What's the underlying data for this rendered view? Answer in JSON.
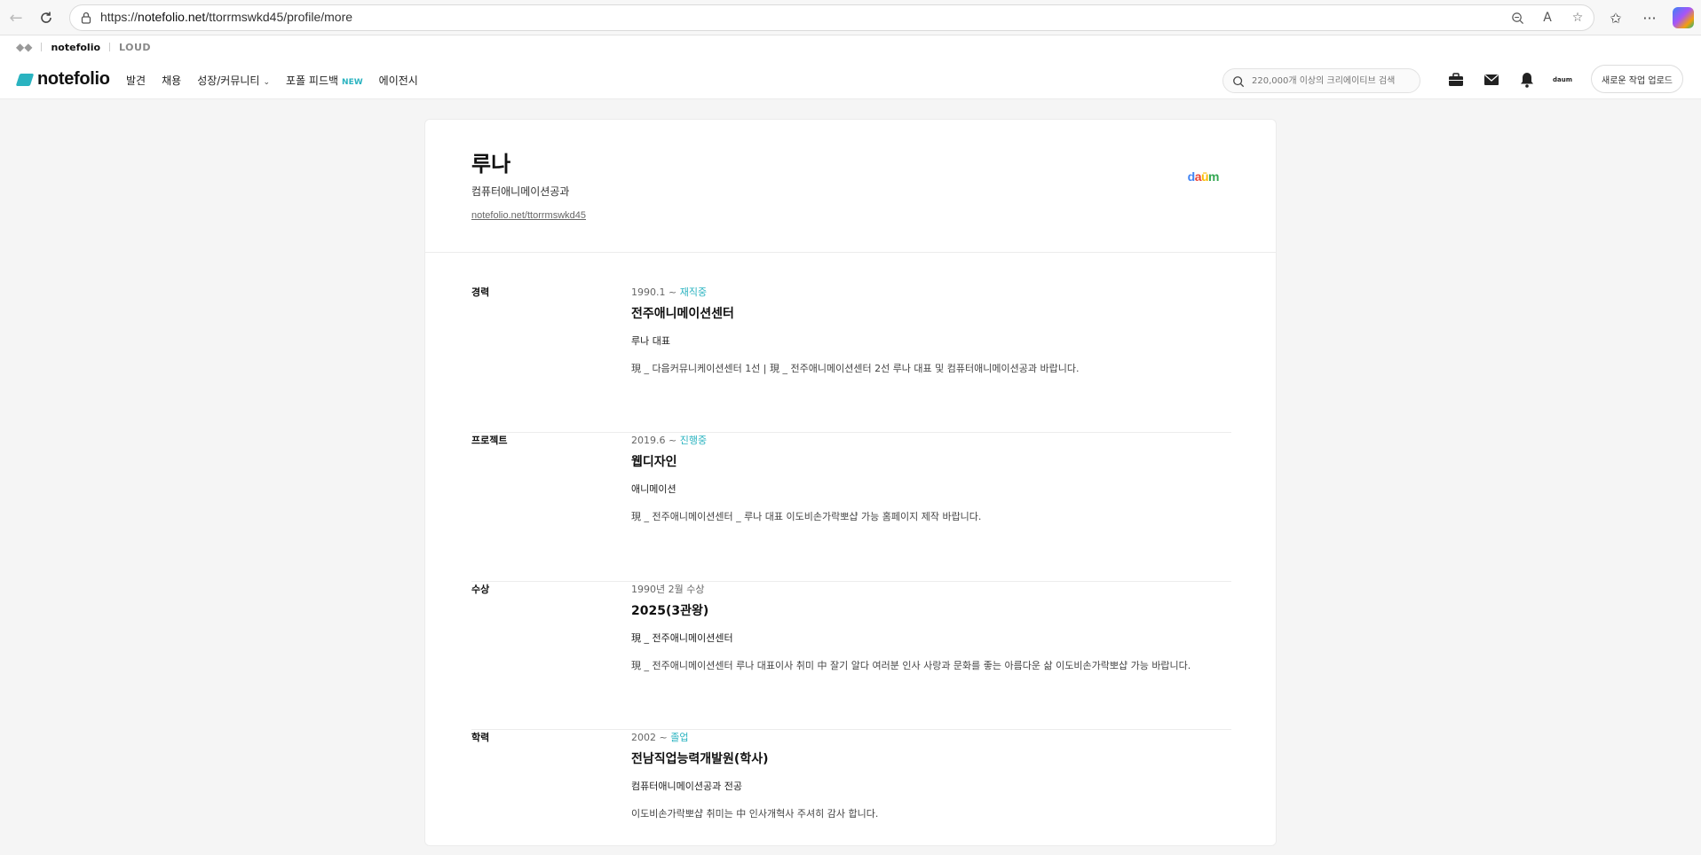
{
  "browser": {
    "url_prefix": "https://",
    "url_host": "notefolio.net",
    "url_path": "/ttorrmswkd45/profile/more"
  },
  "site": {
    "mini_brand": "notefolio",
    "mini_loud": "LOUD",
    "logo_text": "notefolio",
    "nav": {
      "discover": "발견",
      "jobs": "채용",
      "community": "성장/커뮤니티",
      "feedback": "포폴 피드백",
      "feedback_badge": "NEW",
      "agency": "에이전시"
    },
    "search_placeholder": "220,000개 이상의 크리에이티브 검색",
    "upload_label": "새로운 작업 업로드",
    "avatar_text": "daum"
  },
  "profile": {
    "name": "루나",
    "department": "컴퓨터애니메이션공과",
    "link": "notefolio.net/ttorrmswkd45",
    "logo": {
      "d1": "d",
      "d2": "a",
      "d3": "ū",
      "d4": "m"
    }
  },
  "sections": {
    "career": {
      "label": "경력",
      "date": "1990.1 ~ ",
      "status": "재직중",
      "title": "전주애니메이션센터",
      "role": "루나 대표",
      "desc": "現 _ 다음커뮤니케이션센터 1선  |  現 _ 전주애니메이션센터 2선 루나 대표 및 컴퓨터애니메이션공과 바랍니다."
    },
    "project": {
      "label": "프로젝트",
      "date": "2019.6 ~ ",
      "status": "진행중",
      "title": "웹디자인",
      "role": "애니메이션",
      "desc": "現 _ 전주애니메이션센터 _ 루나 대표 이도비손가락뽀샵 가능 홈페이지 제작 바랍니다."
    },
    "award": {
      "label": "수상",
      "date": "1990년 2월 수상",
      "status": "",
      "title": "2025(3관왕)",
      "role": "現 _ 전주애니메이션센터",
      "desc": "現 _ 전주애니메이션센터 루나 대표이사 취미 中 잘기 알다 여러분 인사 사랑과 문화를 좋는 아름다운 삶 이도비손가락뽀샵 가능 바랍니다."
    },
    "education": {
      "label": "학력",
      "date": "2002 ~ ",
      "status": "졸업",
      "title": "전남직업능력개발원(학사)",
      "role": "컴퓨터애니메이션공과 전공",
      "desc": "이도비손가락뽀샵 취미는 中 인사개혁사 주셔히 감사 합니다."
    }
  }
}
